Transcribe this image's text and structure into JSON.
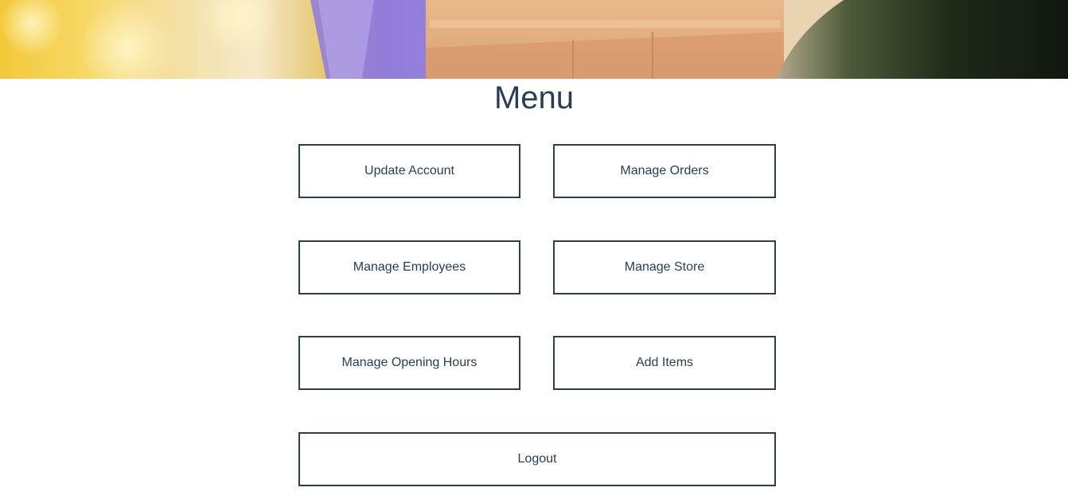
{
  "page": {
    "title": "Menu"
  },
  "hero": {
    "image": "delivery-paper-bags-banner"
  },
  "menu": {
    "update_account": "Update Account",
    "manage_orders": "Manage Orders",
    "manage_employees": "Manage Employees",
    "manage_store": "Manage Store",
    "manage_opening_hours": "Manage Opening Hours",
    "add_items": "Add Items",
    "logout": "Logout"
  },
  "colors": {
    "text": "#2b3e50",
    "border": "#2b3e50",
    "background": "#ffffff"
  }
}
